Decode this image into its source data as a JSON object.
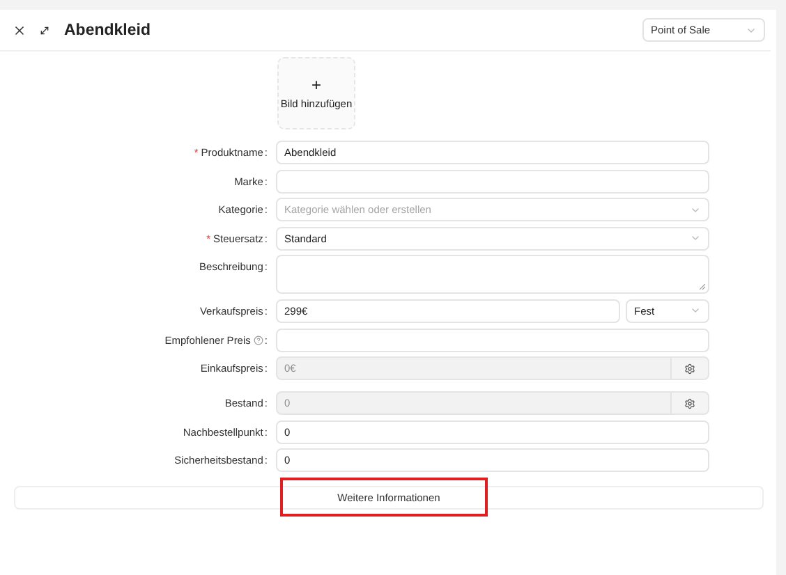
{
  "header": {
    "title": "Abendkleid",
    "channel_select": {
      "value": "Point of Sale"
    }
  },
  "image_upload": {
    "symbol": "+",
    "label": "Bild hinzufügen"
  },
  "fields": [
    {
      "kind": "text",
      "required_mark": "*",
      "label": "Produktname",
      "colon": ":",
      "value": "Abendkleid"
    },
    {
      "kind": "text",
      "label": "Marke",
      "colon": ":"
    },
    {
      "kind": "select",
      "label": "Kategorie",
      "colon": ":",
      "placeholder": "Kategorie wählen oder erstellen"
    },
    {
      "kind": "select",
      "required_mark": "*",
      "label": "Steuersatz",
      "colon": ":",
      "value": "Standard"
    },
    {
      "kind": "textarea",
      "label": "Beschreibung",
      "colon": ":"
    },
    {
      "kind": "price",
      "label": "Verkaufspreis",
      "colon": ":",
      "value": "299€",
      "option": "Fest"
    },
    {
      "kind": "text",
      "label": "Empfohlener Preis",
      "help": true,
      "colon": ":"
    },
    {
      "kind": "addon",
      "label": "Einkaufspreis",
      "colon": ":",
      "placeholder": "0€",
      "disabled": true
    },
    {
      "kind": "addon",
      "label": "Bestand",
      "colon": ":",
      "placeholder": "0",
      "disabled": true
    },
    {
      "kind": "text",
      "label": "Nachbestellpunkt",
      "colon": ":",
      "value": "0"
    },
    {
      "kind": "text",
      "label": "Sicherheitsbestand",
      "colon": ":",
      "value": "0"
    }
  ],
  "more_button": {
    "label": "Weitere Informationen",
    "highlighted": true
  }
}
